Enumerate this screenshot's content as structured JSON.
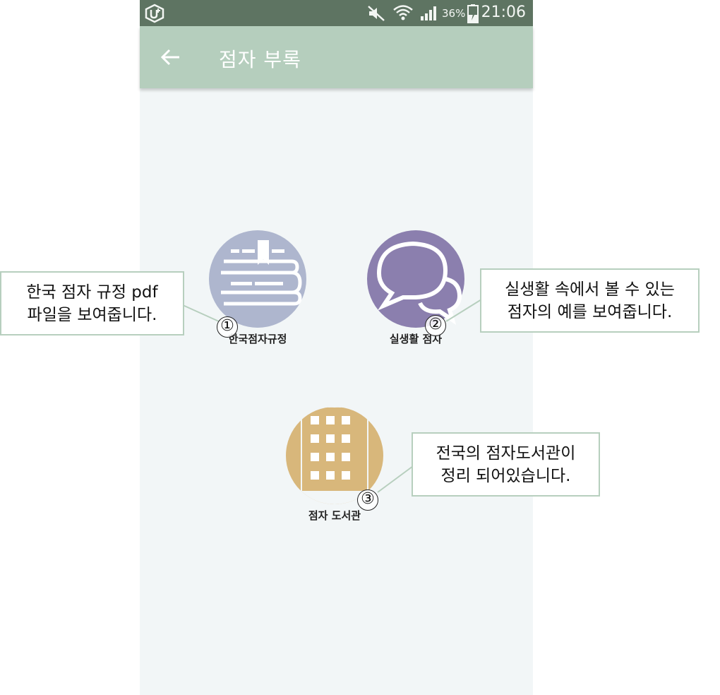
{
  "status_bar": {
    "carrier_icon": "u-plus-icon",
    "icons": [
      "mute-icon",
      "wifi-icon",
      "signal-icon",
      "battery-charging-icon"
    ],
    "battery_percent": "36%",
    "time": "21:06"
  },
  "app_bar": {
    "back_icon": "arrow-left-icon",
    "title": "점자 부록"
  },
  "menu": {
    "items": [
      {
        "label": "한국점자규정",
        "icon": "book-icon",
        "color": "#aeb6ce"
      },
      {
        "label": "실생활 점자",
        "icon": "speech-bubbles-icon",
        "color": "#8b7fae"
      },
      {
        "label": "점자 도서관",
        "icon": "building-icon",
        "color": "#d8b77b"
      }
    ]
  },
  "annotations": [
    {
      "number": "①",
      "lines": [
        "한국 점자 규정 pdf",
        "파일을 보여줍니다."
      ]
    },
    {
      "number": "②",
      "lines": [
        "실생활 속에서 볼 수 있는",
        "점자의 예를 보여줍니다."
      ]
    },
    {
      "number": "③",
      "lines": [
        "전국의 점자도서관이",
        "정리 되어있습니다."
      ]
    }
  ],
  "colors": {
    "status_bar": "#5e7462",
    "app_bar": "#b5cebd",
    "background": "#f2f6f7",
    "callout_border": "#b7cfbe"
  }
}
